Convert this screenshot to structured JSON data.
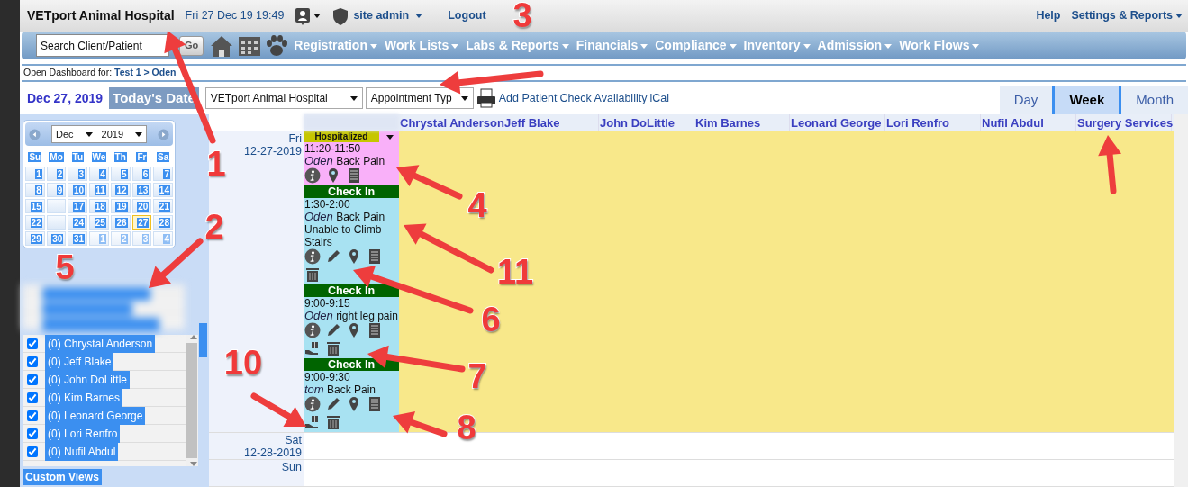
{
  "header": {
    "title": "VETport Animal Hospital",
    "datetime": "Fri 27 Dec 19 19:49",
    "user": "site admin",
    "logout": "Logout",
    "links": [
      "Help",
      "Settings & Reports"
    ]
  },
  "nav": {
    "search": {
      "placeholder": "Search Client/Patient"
    },
    "go": "Go",
    "menus": [
      "Registration",
      "Work Lists",
      "Labs & Reports",
      "Financials",
      "Compliance",
      "Inventory",
      "Admission",
      "Work Flows"
    ]
  },
  "breadcrumb": {
    "prefix": "Open Dashboard for:",
    "link": "Test 1 > Oden"
  },
  "toolbar": {
    "date": "Dec 27, 2019",
    "today": "Today's Date",
    "location": "VETport Animal Hospital",
    "appointment_type": "Appointment Typ",
    "links": [
      "Add Patient",
      "Check Availability",
      "iCal"
    ]
  },
  "views": [
    {
      "label": "Day",
      "selected": false
    },
    {
      "label": "Week",
      "selected": true
    },
    {
      "label": "Month",
      "selected": false
    }
  ],
  "mini_calendar": {
    "month": "Dec",
    "year": "2019",
    "weekdays": [
      "Su",
      "Mo",
      "Tu",
      "We",
      "Th",
      "Fr",
      "Sa"
    ],
    "weeks": [
      [
        {
          "day": "1",
          "selected": false,
          "other_month": false
        },
        {
          "day": "2",
          "selected": false,
          "other_month": false
        },
        {
          "day": "3",
          "selected": false,
          "other_month": false
        },
        {
          "day": "4",
          "selected": false,
          "other_month": false
        },
        {
          "day": "5",
          "selected": false,
          "other_month": false
        },
        {
          "day": "6",
          "selected": false,
          "other_month": false
        },
        {
          "day": "7",
          "selected": false,
          "other_month": false
        }
      ],
      [
        {
          "day": "8",
          "selected": false,
          "other_month": false
        },
        {
          "day": "9",
          "selected": false,
          "other_month": false
        },
        {
          "day": "10",
          "selected": false,
          "other_month": false
        },
        {
          "day": "11",
          "selected": false,
          "other_month": false
        },
        {
          "day": "12",
          "selected": false,
          "other_month": false
        },
        {
          "day": "13",
          "selected": false,
          "other_month": false
        },
        {
          "day": "14",
          "selected": false,
          "other_month": false
        }
      ],
      [
        {
          "day": "15",
          "selected": false,
          "other_month": false
        },
        {
          "selected": false,
          "other_month": false
        },
        {
          "day": "17",
          "selected": false,
          "other_month": false
        },
        {
          "day": "18",
          "selected": false,
          "other_month": false
        },
        {
          "day": "19",
          "selected": false,
          "other_month": false
        },
        {
          "day": "20",
          "selected": false,
          "other_month": false
        },
        {
          "day": "21",
          "selected": false,
          "other_month": false
        }
      ],
      [
        {
          "day": "22",
          "selected": false,
          "other_month": false
        },
        {
          "selected": false,
          "other_month": false
        },
        {
          "day": "24",
          "selected": false,
          "other_month": false
        },
        {
          "day": "25",
          "selected": false,
          "other_month": false
        },
        {
          "day": "26",
          "selected": false,
          "other_month": false
        },
        {
          "day": "27",
          "selected": true,
          "other_month": false
        },
        {
          "day": "28",
          "selected": false,
          "other_month": false
        }
      ],
      [
        {
          "day": "29",
          "selected": false,
          "other_month": false
        },
        {
          "day": "30",
          "selected": false,
          "other_month": false
        },
        {
          "day": "31",
          "selected": false,
          "other_month": false
        },
        {
          "day": "1",
          "selected": false,
          "other_month": true
        },
        {
          "day": "2",
          "selected": false,
          "other_month": true
        },
        {
          "day": "3",
          "selected": false,
          "other_month": true
        },
        {
          "day": "4",
          "selected": false,
          "other_month": true
        }
      ]
    ]
  },
  "provider_list": [
    {
      "label": "(0) Chrystal Anderson",
      "checked": true
    },
    {
      "label": "(0) Jeff Blake",
      "checked": true
    },
    {
      "label": "(0) John DoLittle",
      "checked": true
    },
    {
      "label": "(0) Kim Barnes",
      "checked": true
    },
    {
      "label": "(0) Leonard George",
      "checked": true
    },
    {
      "label": "(0) Lori Renfro",
      "checked": true
    },
    {
      "label": "(0) Nufil Abdul",
      "checked": true
    }
  ],
  "custom_views": "Custom Views",
  "schedule": {
    "columns": [
      "Chrystal Anderson",
      "Jeff Blake",
      "John DoLittle",
      "Kim Barnes",
      "Leonard George",
      "Lori Renfro",
      "Nufil Abdul",
      "Surgery Services"
    ],
    "days": [
      {
        "weekday": "Fri",
        "date": "12-27-2019",
        "appointments": [
          {
            "kind": "hospitalized",
            "status": "Hospitalized",
            "time": "11:20-11:50",
            "patient": "Oden",
            "reason": "Back Pain",
            "actions": [
              {
                "kind": "info"
              },
              {
                "kind": "pin"
              },
              {
                "kind": "notes"
              }
            ]
          },
          {
            "kind": "checkin",
            "status": "Check In",
            "time": "1:30-2:00",
            "patient": "Oden",
            "reason": "Back Pain Unable to Climb Stairs",
            "actions": [
              {
                "kind": "info"
              },
              {
                "kind": "edit"
              },
              {
                "kind": "pin"
              },
              {
                "kind": "notes"
              },
              {
                "kind": "trash"
              }
            ]
          },
          {
            "kind": "checkin",
            "status": "Check In",
            "time": "9:00-9:15",
            "patient": "Oden",
            "reason": "right leg pain",
            "actions": [
              {
                "kind": "info"
              },
              {
                "kind": "edit"
              },
              {
                "kind": "pin"
              },
              {
                "kind": "notes"
              },
              {
                "kind": "hand"
              },
              {
                "kind": "trash"
              }
            ]
          },
          {
            "kind": "checkin",
            "status": "Check In",
            "time": "9:00-9:30",
            "patient": "tom",
            "reason": "Back Pain",
            "actions": [
              {
                "kind": "info"
              },
              {
                "kind": "edit"
              },
              {
                "kind": "pin"
              },
              {
                "kind": "notes"
              },
              {
                "kind": "hand"
              },
              {
                "kind": "trash"
              }
            ]
          }
        ]
      },
      {
        "weekday": "Sat",
        "date": "12-28-2019"
      },
      {
        "weekday": "Sun"
      }
    ]
  },
  "callouts": [
    "1",
    "2",
    "3",
    "4",
    "5",
    "6",
    "7",
    "8",
    "10",
    "11"
  ]
}
